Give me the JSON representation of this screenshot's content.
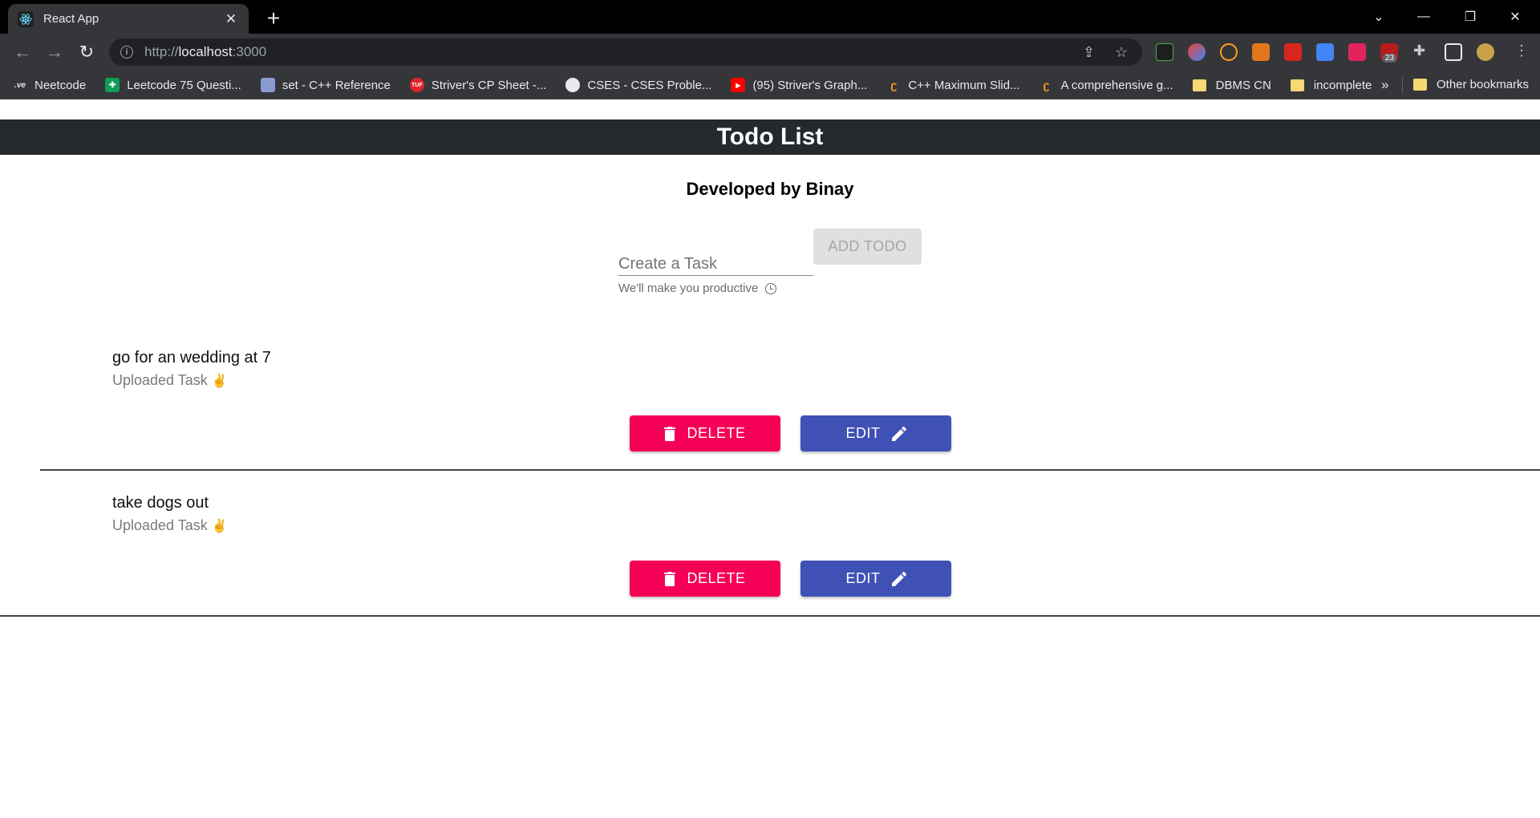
{
  "browser": {
    "tab_title": "React App",
    "url_scheme": "http://",
    "url_host": "localhost",
    "url_port": ":3000",
    "extension_badge": "23",
    "bookmarks": [
      {
        "label": "Neetcode",
        "icon": "neetcode-icon",
        "color": "#35363a"
      },
      {
        "label": "Leetcode 75 Questi...",
        "icon": "sheets-icon",
        "color": "#0f9d58"
      },
      {
        "label": "set - C++ Reference",
        "icon": "cpp-reference-icon",
        "color": "#8a9bd1"
      },
      {
        "label": "Striver's CP Sheet -...",
        "icon": "tuf-icon",
        "color": "#e0242b"
      },
      {
        "label": "CSES - CSES Proble...",
        "icon": "globe-icon",
        "color": "#e8eaed"
      },
      {
        "label": "(95) Striver's Graph...",
        "icon": "youtube-icon",
        "color": "#ff0000"
      },
      {
        "label": "C++ Maximum Slid...",
        "icon": "leetcode-icon",
        "color": "#ffa116"
      },
      {
        "label": "A comprehensive g...",
        "icon": "leetcode-icon",
        "color": "#ffa116"
      },
      {
        "label": "DBMS CN",
        "icon": "folder-icon",
        "color": "#f8d775"
      },
      {
        "label": "incomplete",
        "icon": "folder-icon",
        "color": "#f8d775"
      }
    ],
    "more_label": "»",
    "other_bookmarks": "Other bookmarks"
  },
  "app": {
    "title": "Todo List",
    "subtitle": "Developed by Binay",
    "input_placeholder": "Create a Task",
    "helper_text": "We'll make you productive",
    "add_button": "ADD TODO"
  },
  "todos": [
    {
      "text": "go for an wedding at 7",
      "subtext": "Uploaded Task",
      "emoji": "✌",
      "delete_label": "DELETE",
      "edit_label": "EDIT"
    },
    {
      "text": "take dogs out",
      "subtext": "Uploaded Task",
      "emoji": "✌",
      "delete_label": "DELETE",
      "edit_label": "EDIT"
    }
  ],
  "colors": {
    "appbar": "#24292e",
    "delete": "#f50057",
    "edit": "#3f51b5",
    "add_disabled": "#e0e0e0"
  }
}
